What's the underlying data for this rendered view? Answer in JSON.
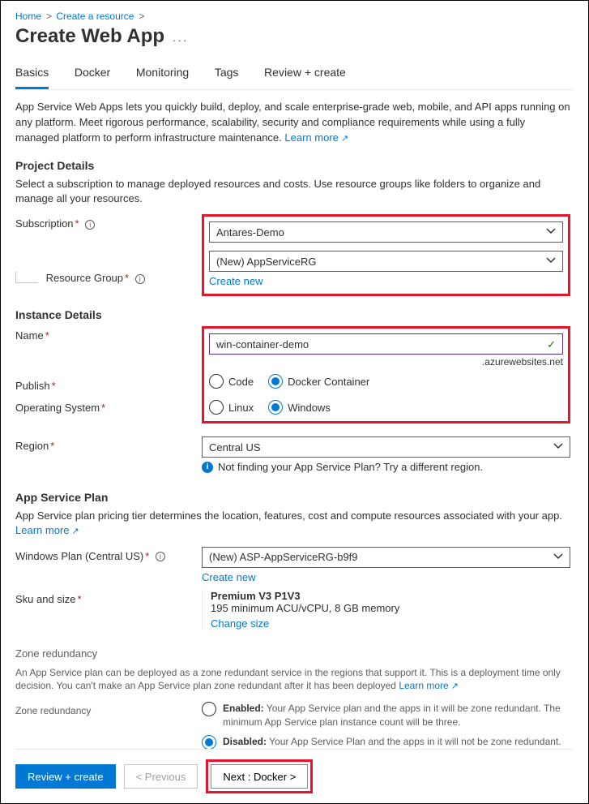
{
  "breadcrumb": {
    "home": "Home",
    "create": "Create a resource"
  },
  "title": "Create Web App",
  "tabs": [
    "Basics",
    "Docker",
    "Monitoring",
    "Tags",
    "Review + create"
  ],
  "intro": {
    "text": "App Service Web Apps lets you quickly build, deploy, and scale enterprise-grade web, mobile, and API apps running on any platform. Meet rigorous performance, scalability, security and compliance requirements while using a fully managed platform to perform infrastructure maintenance.",
    "learn": "Learn more"
  },
  "project": {
    "heading": "Project Details",
    "desc": "Select a subscription to manage deployed resources and costs. Use resource groups like folders to organize and manage all your resources.",
    "subscription_label": "Subscription",
    "subscription_value": "Antares-Demo",
    "rg_label": "Resource Group",
    "rg_value": "(New) AppServiceRG",
    "create_new": "Create new"
  },
  "instance": {
    "heading": "Instance Details",
    "name_label": "Name",
    "name_value": "win-container-demo",
    "domain_suffix": ".azurewebsites.net",
    "publish_label": "Publish",
    "publish_options": {
      "code": "Code",
      "docker": "Docker Container"
    },
    "os_label": "Operating System",
    "os_options": {
      "linux": "Linux",
      "windows": "Windows"
    },
    "region_label": "Region",
    "region_value": "Central US",
    "region_hint": "Not finding your App Service Plan? Try a different region."
  },
  "plan": {
    "heading": "App Service Plan",
    "desc": "App Service plan pricing tier determines the location, features, cost and compute resources associated with your app.",
    "learn": "Learn more",
    "plan_label": "Windows Plan (Central US)",
    "plan_value": "(New) ASP-AppServiceRG-b9f9",
    "create_new": "Create new",
    "sku_label": "Sku and size",
    "sku_name": "Premium V3 P1V3",
    "sku_detail": "195 minimum ACU/vCPU, 8 GB memory",
    "change_size": "Change size"
  },
  "zone": {
    "heading": "Zone redundancy",
    "desc": "An App Service plan can be deployed as a zone redundant service in the regions that support it. This is a deployment time only decision. You can't make an App Service plan zone redundant after it has been deployed",
    "learn": "Learn more",
    "field_label": "Zone redundancy",
    "enabled_title": "Enabled:",
    "enabled_text": " Your App Service plan and the apps in it will be zone redundant. The minimum App Service plan instance count will be three.",
    "disabled_title": "Disabled:",
    "disabled_text": " Your App Service Plan and the apps in it will not be zone redundant. The minimum App Service plan instance count will be one."
  },
  "footer": {
    "review": "Review + create",
    "previous": "< Previous",
    "next": "Next : Docker >"
  }
}
